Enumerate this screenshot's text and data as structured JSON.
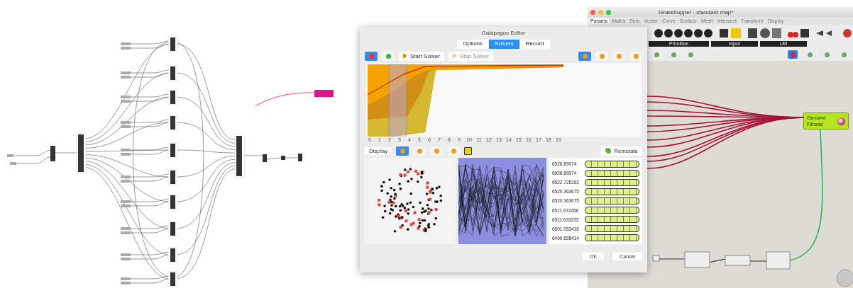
{
  "galapagos_editor": {
    "title": "Galapagos Editor",
    "tabs": [
      {
        "label": "Options",
        "selected": false
      },
      {
        "label": "Solvers",
        "selected": true
      },
      {
        "label": "Record",
        "selected": false
      }
    ],
    "mode_buttons": [
      {
        "selected": true
      },
      {
        "selected": false
      }
    ],
    "solver_buttons": [
      {
        "label": "Start Solver",
        "disabled": false
      },
      {
        "label": "Stop Solver",
        "disabled": true
      }
    ],
    "view_buttons": [
      {
        "selected": true
      },
      {
        "selected": false
      },
      {
        "selected": false
      },
      {
        "selected": false
      }
    ],
    "axis_ticks": [
      "0",
      "1",
      "2",
      "3",
      "4",
      "5",
      "6",
      "7",
      "8",
      "9",
      "10",
      "11",
      "12",
      "13",
      "14",
      "15",
      "16",
      "17",
      "18",
      "19"
    ],
    "display_label": "Display",
    "display_modes": [
      {
        "selected": true
      },
      {
        "selected": false
      },
      {
        "selected": false
      },
      {
        "selected": false
      }
    ],
    "reinstate_label": "Reinstate",
    "genomes": [
      "6526.89074",
      "6526.89074",
      "6522.725392",
      "6520.363675",
      "6520.363675",
      "6511.972456",
      "6511.633233",
      "6501.053416",
      "6499.595414"
    ],
    "buttons": [
      "OK",
      "Cancel"
    ]
  },
  "grasshopper": {
    "title": "Grasshopper - standard map*",
    "menu_tabs": [
      {
        "label": "Params",
        "selected": true
      },
      {
        "label": "Maths",
        "selected": false
      },
      {
        "label": "Sets",
        "selected": false
      },
      {
        "label": "Vector",
        "selected": false
      },
      {
        "label": "Curve",
        "selected": false
      },
      {
        "label": "Surface",
        "selected": false
      },
      {
        "label": "Mesh",
        "selected": false
      },
      {
        "label": "Intersect",
        "selected": false
      },
      {
        "label": "Transform",
        "selected": false
      },
      {
        "label": "Display",
        "selected": false
      }
    ],
    "toolbar_groups": [
      "Primitive",
      "Input",
      "Util"
    ],
    "canvas_tools": [
      {
        "selected": false
      },
      {
        "selected": false
      },
      {
        "selected": false
      },
      {
        "selected": true
      },
      {
        "selected": false
      },
      {
        "selected": false
      },
      {
        "selected": false
      }
    ],
    "genome_node": {
      "inputs": [
        "Genome",
        "Fitness"
      ]
    }
  }
}
